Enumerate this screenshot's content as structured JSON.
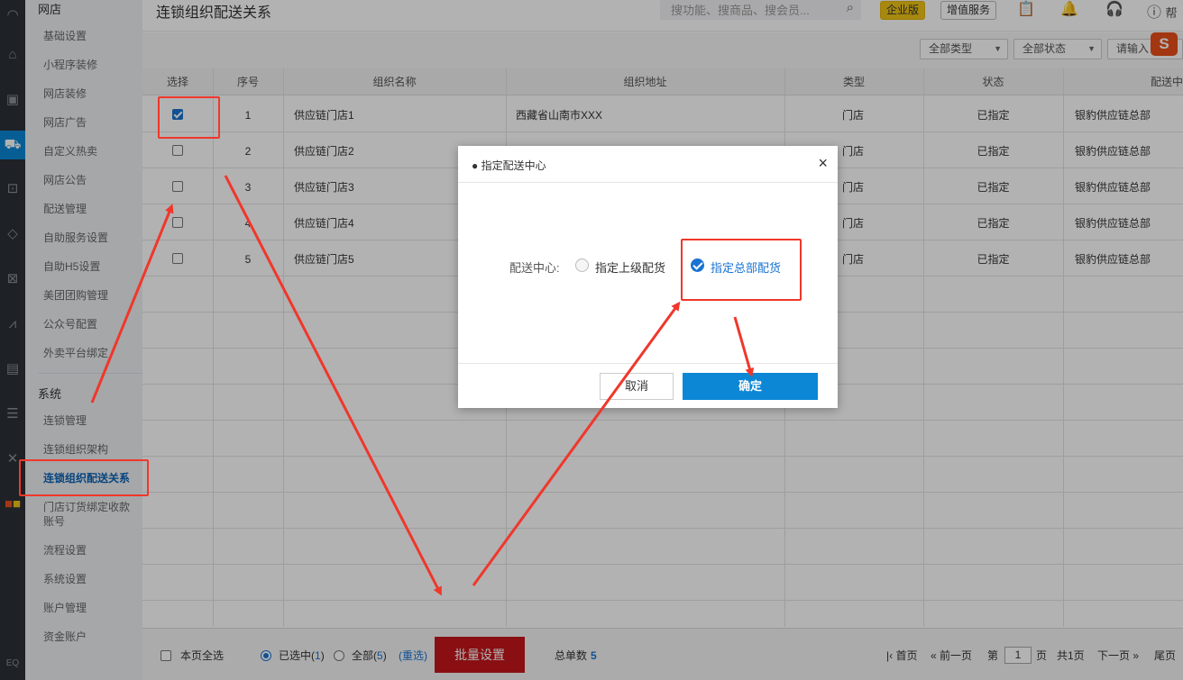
{
  "rail_icons": [
    "logo-icon",
    "home-icon",
    "money-icon",
    "delivery-icon",
    "box-icon",
    "diamond-icon",
    "coupon-icon",
    "chart-icon",
    "card-icon",
    "settings-icon",
    "tools-icon",
    "apps-icon",
    "eq-icon"
  ],
  "sidebar": {
    "section1": "网店",
    "items": [
      "基础设置",
      "小程序装修",
      "网店装修",
      "网店广告",
      "自定义热卖",
      "网店公告",
      "配送管理",
      "自助服务设置",
      "自助H5设置",
      "美团团购管理",
      "公众号配置",
      "外卖平台绑定"
    ],
    "section2": "系统",
    "items2": [
      "连锁管理",
      "连锁组织架构",
      "连锁组织配送关系",
      "门店订货绑定收款账号",
      "流程设置",
      "系统设置",
      "账户管理",
      "资金账户"
    ]
  },
  "header": {
    "title": "连锁组织配送关系",
    "search_placeholder": "搜功能、搜商品、搜会员...",
    "enterprise": "企业版",
    "value_added": "增值服务",
    "help": "帮"
  },
  "toolbar": {
    "type_select": "全部类型",
    "status_select": "全部状态",
    "input_placeholder": "请输入"
  },
  "table": {
    "headers": [
      "选择",
      "序号",
      "组织名称",
      "组织地址",
      "类型",
      "状态",
      "配送中"
    ],
    "rows": [
      {
        "checked": true,
        "no": "1",
        "name": "供应链门店1",
        "address": "西藏省山南市XXX",
        "type": "门店",
        "status": "已指定",
        "center": "银豹供应链总部"
      },
      {
        "checked": false,
        "no": "2",
        "name": "供应链门店2",
        "address": "",
        "type": "门店",
        "status": "已指定",
        "center": "银豹供应链总部"
      },
      {
        "checked": false,
        "no": "3",
        "name": "供应链门店3",
        "address": "",
        "type": "门店",
        "status": "已指定",
        "center": "银豹供应链总部"
      },
      {
        "checked": false,
        "no": "4",
        "name": "供应链门店4",
        "address": "",
        "type": "门店",
        "status": "已指定",
        "center": "银豹供应链总部"
      },
      {
        "checked": false,
        "no": "5",
        "name": "供应链门店5",
        "address": "",
        "type": "门店",
        "status": "已指定",
        "center": "银豹供应链总部"
      }
    ]
  },
  "pager": {
    "page_all": "本页全选",
    "selected": "已选中(",
    "selected_count": "1",
    "selected_close": ")",
    "all": "全部(",
    "all_count": "5",
    "all_close": ")",
    "reselect": "(重选)",
    "batch": "批量设置",
    "total_label": "总单数",
    "total": "5",
    "first": "首页",
    "prev": "前一页",
    "page_pre": "第",
    "page": "1",
    "page_post": "页",
    "pages": "共1页",
    "next": "下一页",
    "last": "尾页"
  },
  "dialog": {
    "title": "● 指定配送中心",
    "close": "×",
    "label": "配送中心:",
    "option1": "指定上级配货",
    "option2": "指定总部配货",
    "cancel": "取消",
    "ok": "确定"
  },
  "annotation_color": "#f0372b",
  "accent": "#0b87d6"
}
